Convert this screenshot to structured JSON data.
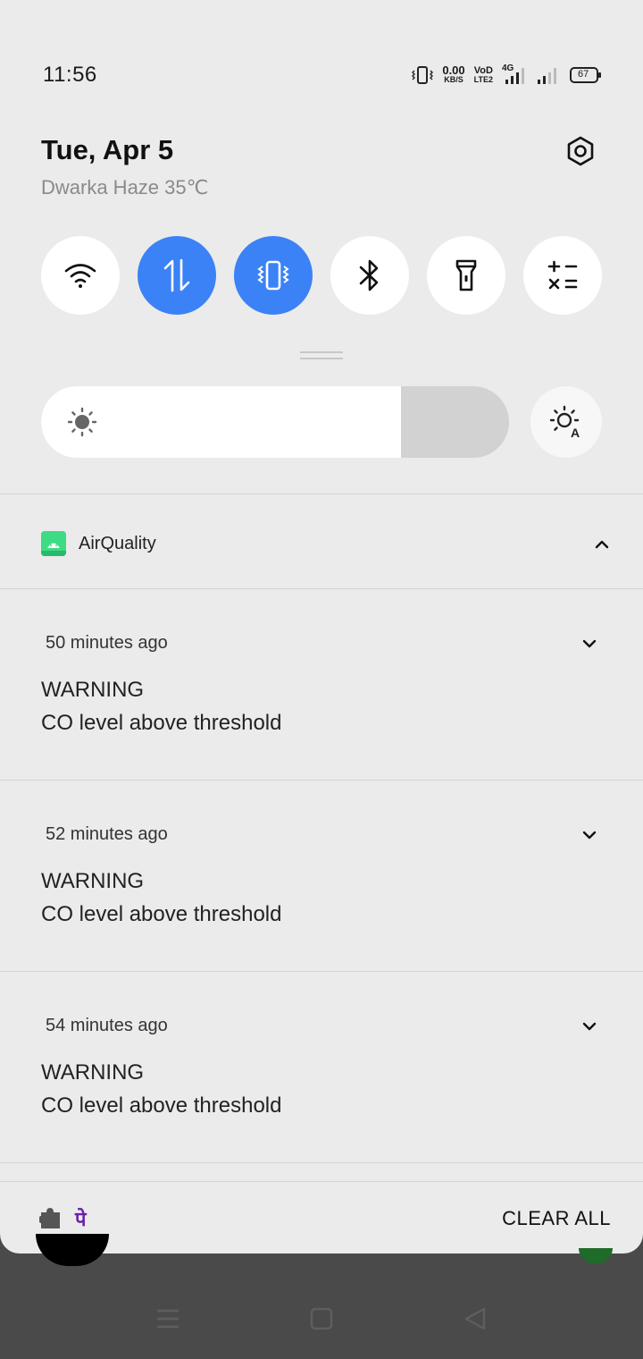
{
  "status_bar": {
    "time": "11:56",
    "net_speed_value": "0.00",
    "net_speed_unit": "KB/S",
    "volte_top": "VoD",
    "volte_bottom": "LTE2",
    "network_type": "4G",
    "battery": "67"
  },
  "header": {
    "date": "Tue, Apr 5",
    "weather": "Dwarka Haze 35℃"
  },
  "quick_toggles": [
    {
      "name": "wifi",
      "icon": "wifi-icon",
      "active": false
    },
    {
      "name": "mobile-data",
      "icon": "data-arrows-icon",
      "active": true
    },
    {
      "name": "vibrate",
      "icon": "vibrate-icon",
      "active": true
    },
    {
      "name": "bluetooth",
      "icon": "bluetooth-icon",
      "active": false
    },
    {
      "name": "flashlight",
      "icon": "flashlight-icon",
      "active": false
    },
    {
      "name": "calculator",
      "icon": "calculator-icon",
      "active": false
    }
  ],
  "brightness": {
    "level_fraction": 0.77
  },
  "notification_group": {
    "app_name": "AirQuality",
    "notifications": [
      {
        "time": "50 minutes ago",
        "title": "WARNING",
        "body": "CO level above threshold"
      },
      {
        "time": "52 minutes ago",
        "title": "WARNING",
        "body": "CO level above threshold"
      },
      {
        "time": "54 minutes ago",
        "title": "WARNING",
        "body": "CO level above threshold"
      }
    ]
  },
  "footer": {
    "phonepe_glyph": "पे",
    "clear_all_label": "CLEAR ALL"
  },
  "colors": {
    "active_toggle": "#3b82f6",
    "shade_background": "#ebebeb",
    "app_icon": "#3ddc84"
  }
}
